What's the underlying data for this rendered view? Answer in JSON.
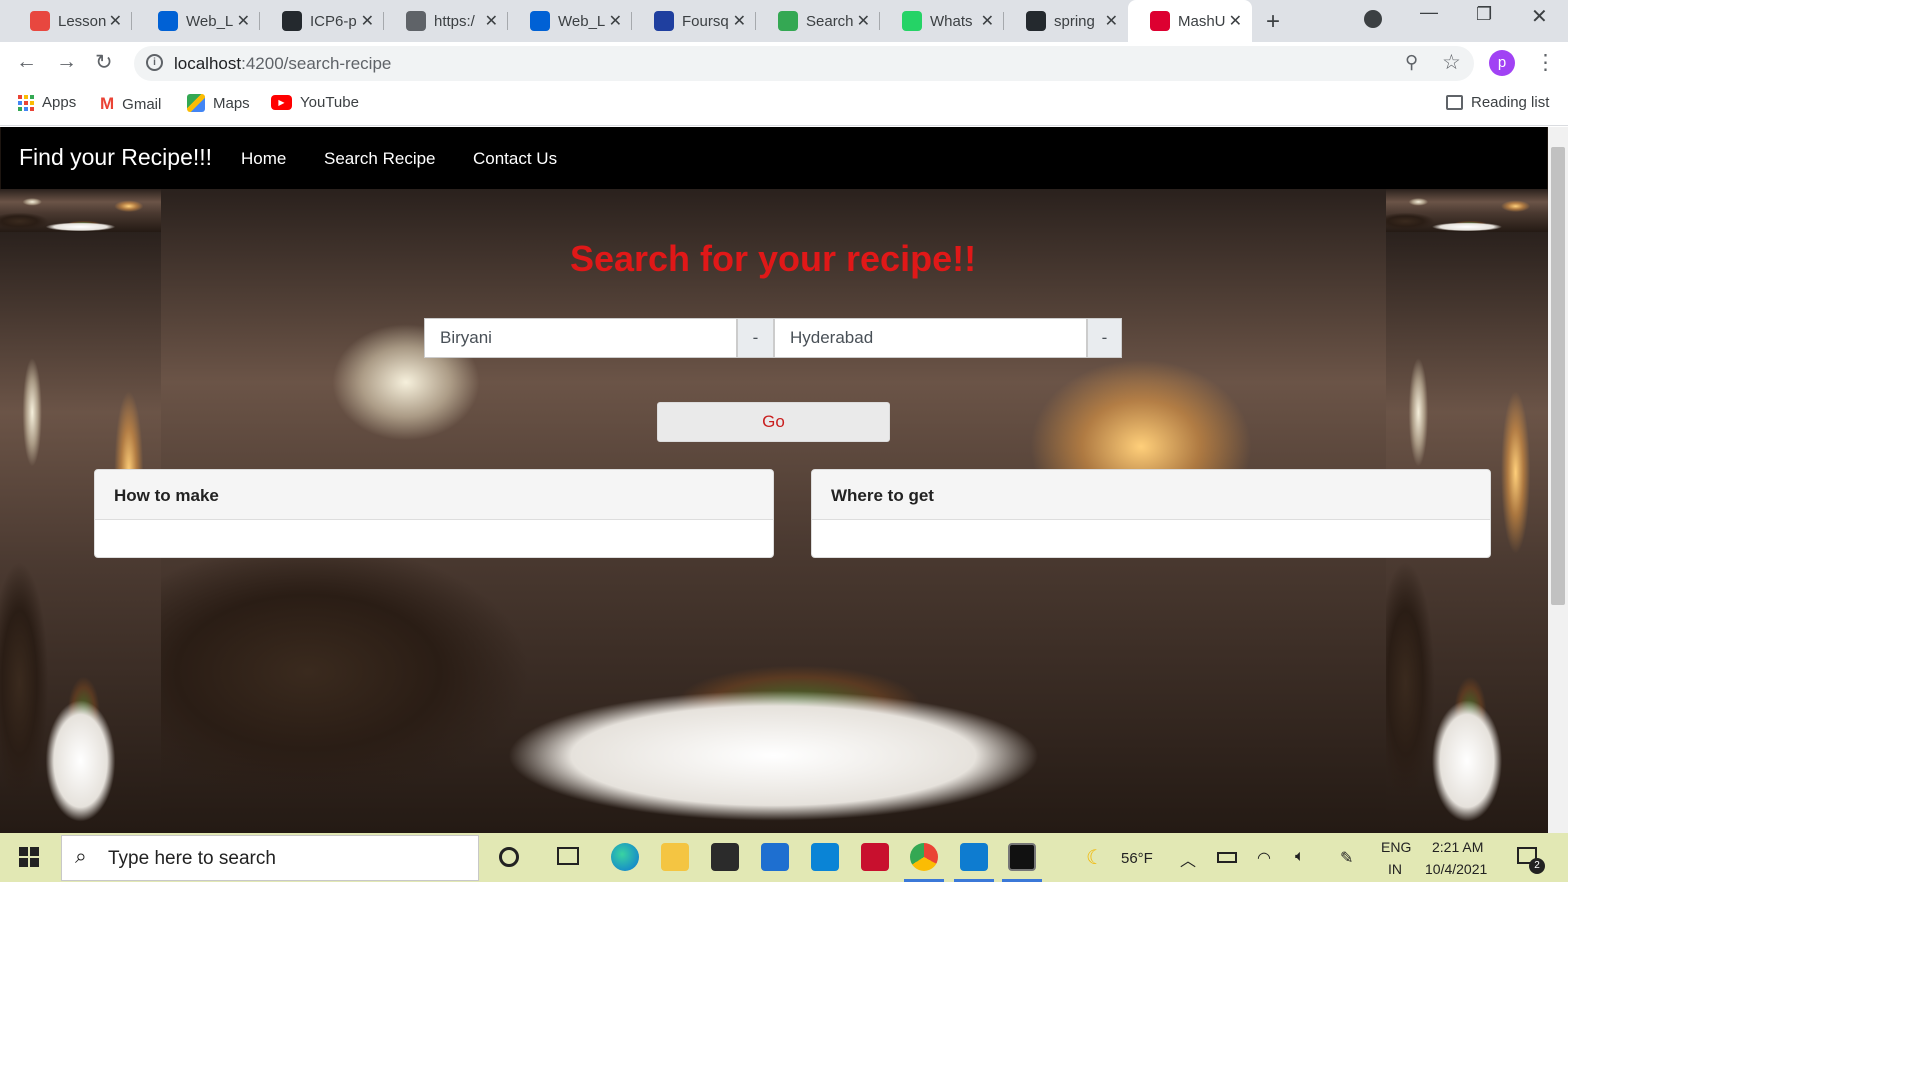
{
  "browser": {
    "tabs": [
      {
        "title": "Lesson",
        "favicon": "gear-red-icon",
        "color": "#e8473f"
      },
      {
        "title": "Web_L",
        "favicon": "box-icon",
        "color": "#0061d5"
      },
      {
        "title": "ICP6-p",
        "favicon": "github-icon",
        "color": "#24292e"
      },
      {
        "title": "https:/",
        "favicon": "globe-icon",
        "color": "#5f6368"
      },
      {
        "title": "Web_L",
        "favicon": "box-icon",
        "color": "#0061d5"
      },
      {
        "title": "Foursq",
        "favicon": "foursquare-icon",
        "color": "#1f3f9f"
      },
      {
        "title": "Search",
        "favicon": "google-drive-icon",
        "color": "#34a853"
      },
      {
        "title": "Whats",
        "favicon": "whatsapp-icon",
        "color": "#25d366"
      },
      {
        "title": "spring",
        "favicon": "github-icon",
        "color": "#24292e"
      },
      {
        "title": "MashU",
        "favicon": "angular-icon",
        "color": "#dd0031"
      }
    ],
    "url_host": "localhost",
    "url_path": ":4200/search-recipe",
    "profile_initial": "p",
    "bookmarks": [
      {
        "label": "Apps",
        "icon": "apps-grid-icon"
      },
      {
        "label": "Gmail",
        "icon": "gmail-icon"
      },
      {
        "label": "Maps",
        "icon": "maps-icon"
      },
      {
        "label": "YouTube",
        "icon": "youtube-icon"
      }
    ],
    "reading_list": "Reading list"
  },
  "app": {
    "brand": "Find your Recipe!!!",
    "nav": [
      "Home",
      "Search Recipe",
      "Contact Us"
    ],
    "heading": "Search for your recipe!!",
    "recipe_value": "Biryani",
    "recipe_addon": "-",
    "location_value": "Hyderabad",
    "location_addon": "-",
    "go_label": "Go",
    "card_how": "How to make",
    "card_where": "Where to get"
  },
  "taskbar": {
    "search_placeholder": "Type here to search",
    "temperature": "56°F",
    "lang_top": "ENG",
    "lang_bottom": "IN",
    "time": "2:21 AM",
    "date": "10/4/2021",
    "notifications": "2"
  },
  "colors": {
    "heading": "#e01818",
    "navbar": "#000000",
    "go_text": "#c91e1e"
  }
}
